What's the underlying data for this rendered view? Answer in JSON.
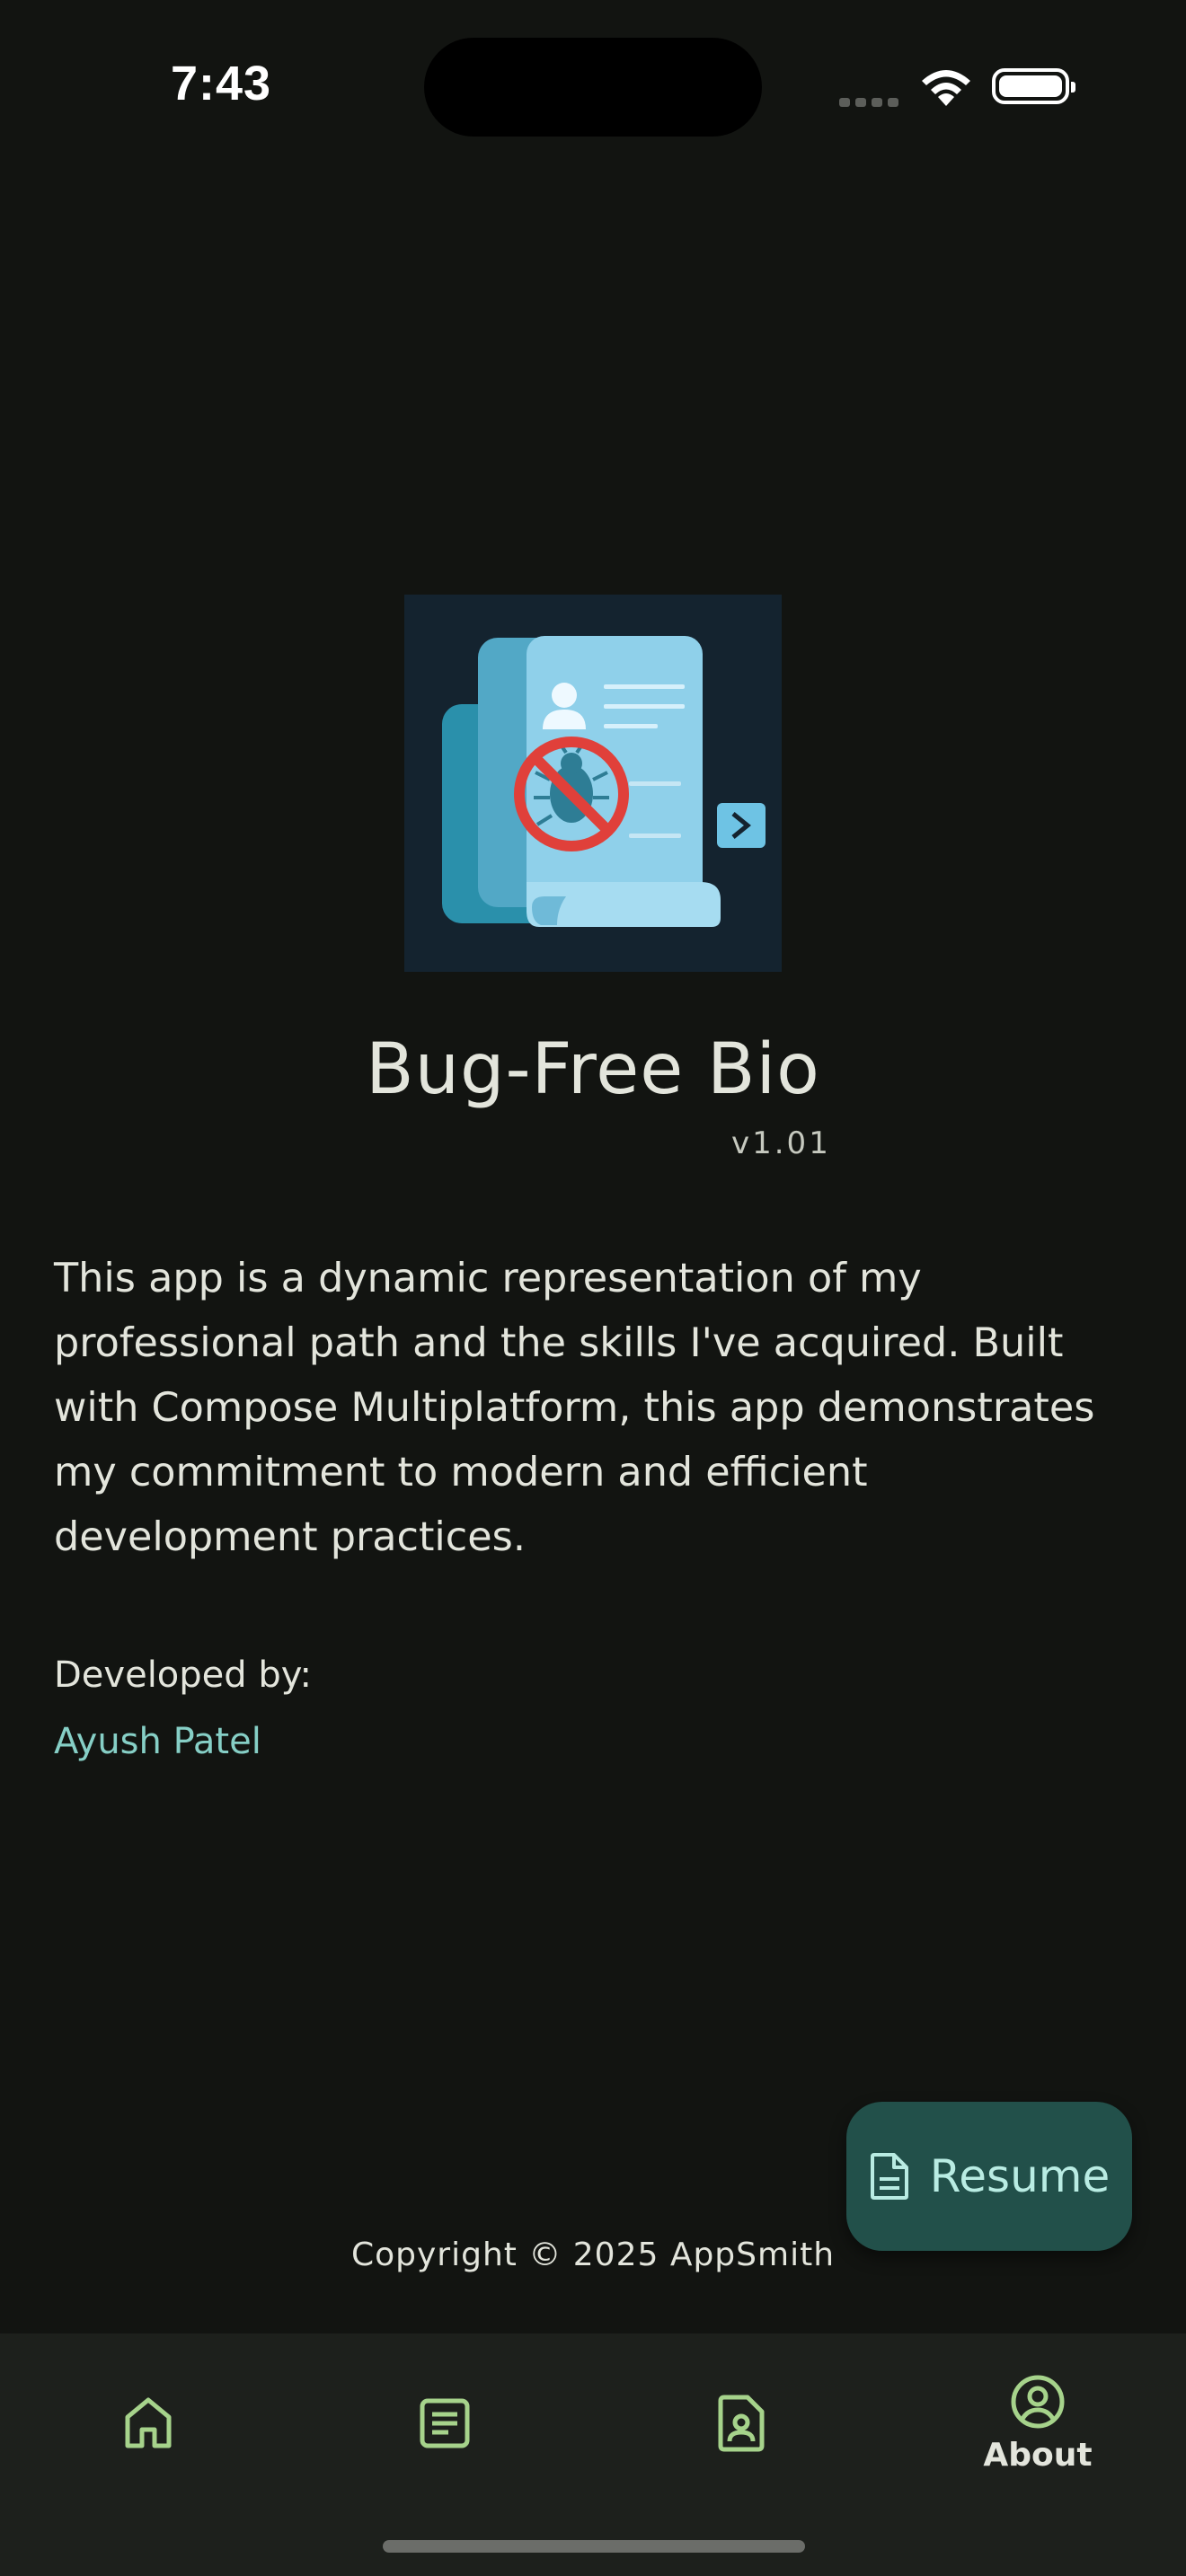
{
  "status_bar": {
    "time": "7:43"
  },
  "app": {
    "name": "Bug-Free Bio",
    "version": "v1.01",
    "description": "This app is a dynamic representation of my professional path and the skills I've acquired. Built with Compose Multiplatform, this app demonstrates my commitment to modern and efficient development practices.",
    "developed_by_label": "Developed by:",
    "developer_name": "Ayush Patel",
    "copyright": "Copyright © 2025 AppSmith"
  },
  "fab": {
    "label": "Resume",
    "icon": "document-icon"
  },
  "bottom_nav": {
    "items": [
      {
        "icon": "home-icon",
        "label": ""
      },
      {
        "icon": "article-icon",
        "label": ""
      },
      {
        "icon": "contact-page-icon",
        "label": ""
      },
      {
        "icon": "account-circle-icon",
        "label": "About",
        "selected": true
      }
    ]
  },
  "colors": {
    "background": "#121411",
    "accent_link": "#86cfc6",
    "fab_background": "#22504a",
    "nav_icon": "#a6d38b",
    "nav_background": "#1d201c"
  }
}
